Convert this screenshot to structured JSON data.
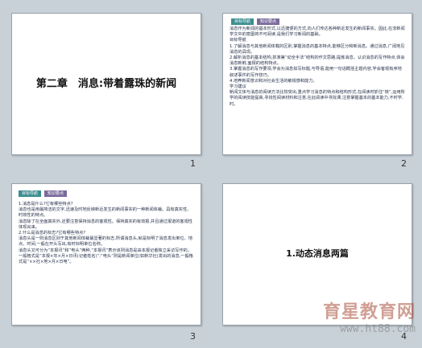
{
  "slides": [
    {
      "number": "1",
      "title": "第二章　消息:带着露珠的新闻"
    },
    {
      "number": "2",
      "tabs": [
        "目标导航",
        "知识要点"
      ],
      "lines": [
        "消息作为新闻的基本形式,以迅捷便的方式,向人们传达各种新近发生的新闻事实。因此,在非新闻学文中的意图将不可阅读,是我们学习新闻的基础。",
        "目标导航",
        "1.了解消息与其他新闻体载的区别,掌握消息的基本特点,能够区分和新消息。通过消息,广阔地见消息的具现。",
        "2.解析消息的基本结构,抓准第“动全手法”结构的作文思路,提炼消息。认识消息的写作特点,体会消息新鲜,面报的结构特点。",
        "3.掌握消息的写作要领,学会为消息拟写标题,与导语,能用一句话概括主题内容,学会客观有序地叙述事件的写作技巧。",
        "4.培养新闻意识和对社会生活的敏锐感和能力。",
        "学习建议",
        "新闻文体与消息的阅读方法比较突出,重点学习消息的特点和结构形式,在阅读时抓住“核”,运用所学的阅读技能提高,寻找性阅读材料和注意,在此阅读中寻找课,注意掌握基本的基本能力,不时学,时。"
      ]
    },
    {
      "number": "3",
      "tabs": [
        "目标导航",
        "知识要点"
      ],
      "lines": [
        "1.消息是什么?它有哪些特点?",
        "消息也是用最简洁的文字,迅速及时地反映新近发生的新闻事实的一种新闻体裁。具有真实性、时效性的特点。",
        "消息除了在全面真实外,还要注意保持消息的客观性。保持真实的有效报,并且通过报道的客观性体现出来。",
        "2.什么是消息的标志?它有哪些特点?",
        "消息头是一则消息区别于其他新闻体裁最显著的标志,所谓消息头,就是标明了消息发出单位、地点、时间,一般在开头写出,有时标明单位名称。",
        "消息头又可分为“本报讯”和“电头”两种,“本报讯”表示该则消息是由本报记者独立采访写作的。一般格式是“本报×年×月×日讯(记者姓名)”;“电头”则是新闻单位(如新华社)发出的消息,一般格式是“××社×地×月×日电”。"
      ]
    },
    {
      "number": "4",
      "title": "1.动态消息两篇"
    }
  ],
  "watermark": {
    "main": "育星教育网",
    "url": "www.ht88.com"
  }
}
